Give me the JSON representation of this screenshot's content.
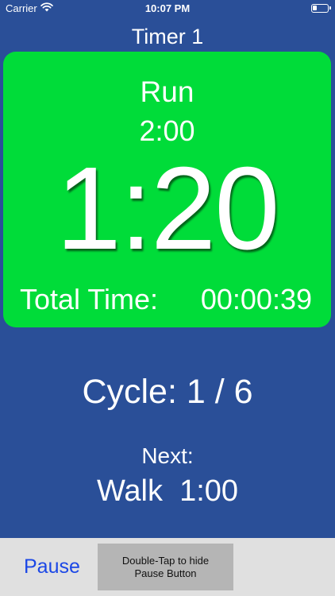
{
  "status_bar": {
    "carrier": "Carrier",
    "time": "10:07 PM",
    "wifi_icon": "wifi-icon",
    "battery_icon": "battery-icon"
  },
  "timer": {
    "name": "Timer 1",
    "phase": "Run",
    "phase_duration": "2:00",
    "countdown": "1:20",
    "total_label": "Total Time:",
    "total_value": "00:00:39",
    "card_color": "#00dc39"
  },
  "cycle": {
    "text": "Cycle: 1 / 6"
  },
  "next": {
    "label": "Next:",
    "value": "Walk  1:00"
  },
  "controls": {
    "pause_label": "Pause",
    "hint_line1": "Double-Tap to hide",
    "hint_line2": "Pause Button"
  },
  "colors": {
    "background": "#2a4f98",
    "accent": "#1b47e6",
    "bottom_bar": "#e0e0e0"
  }
}
